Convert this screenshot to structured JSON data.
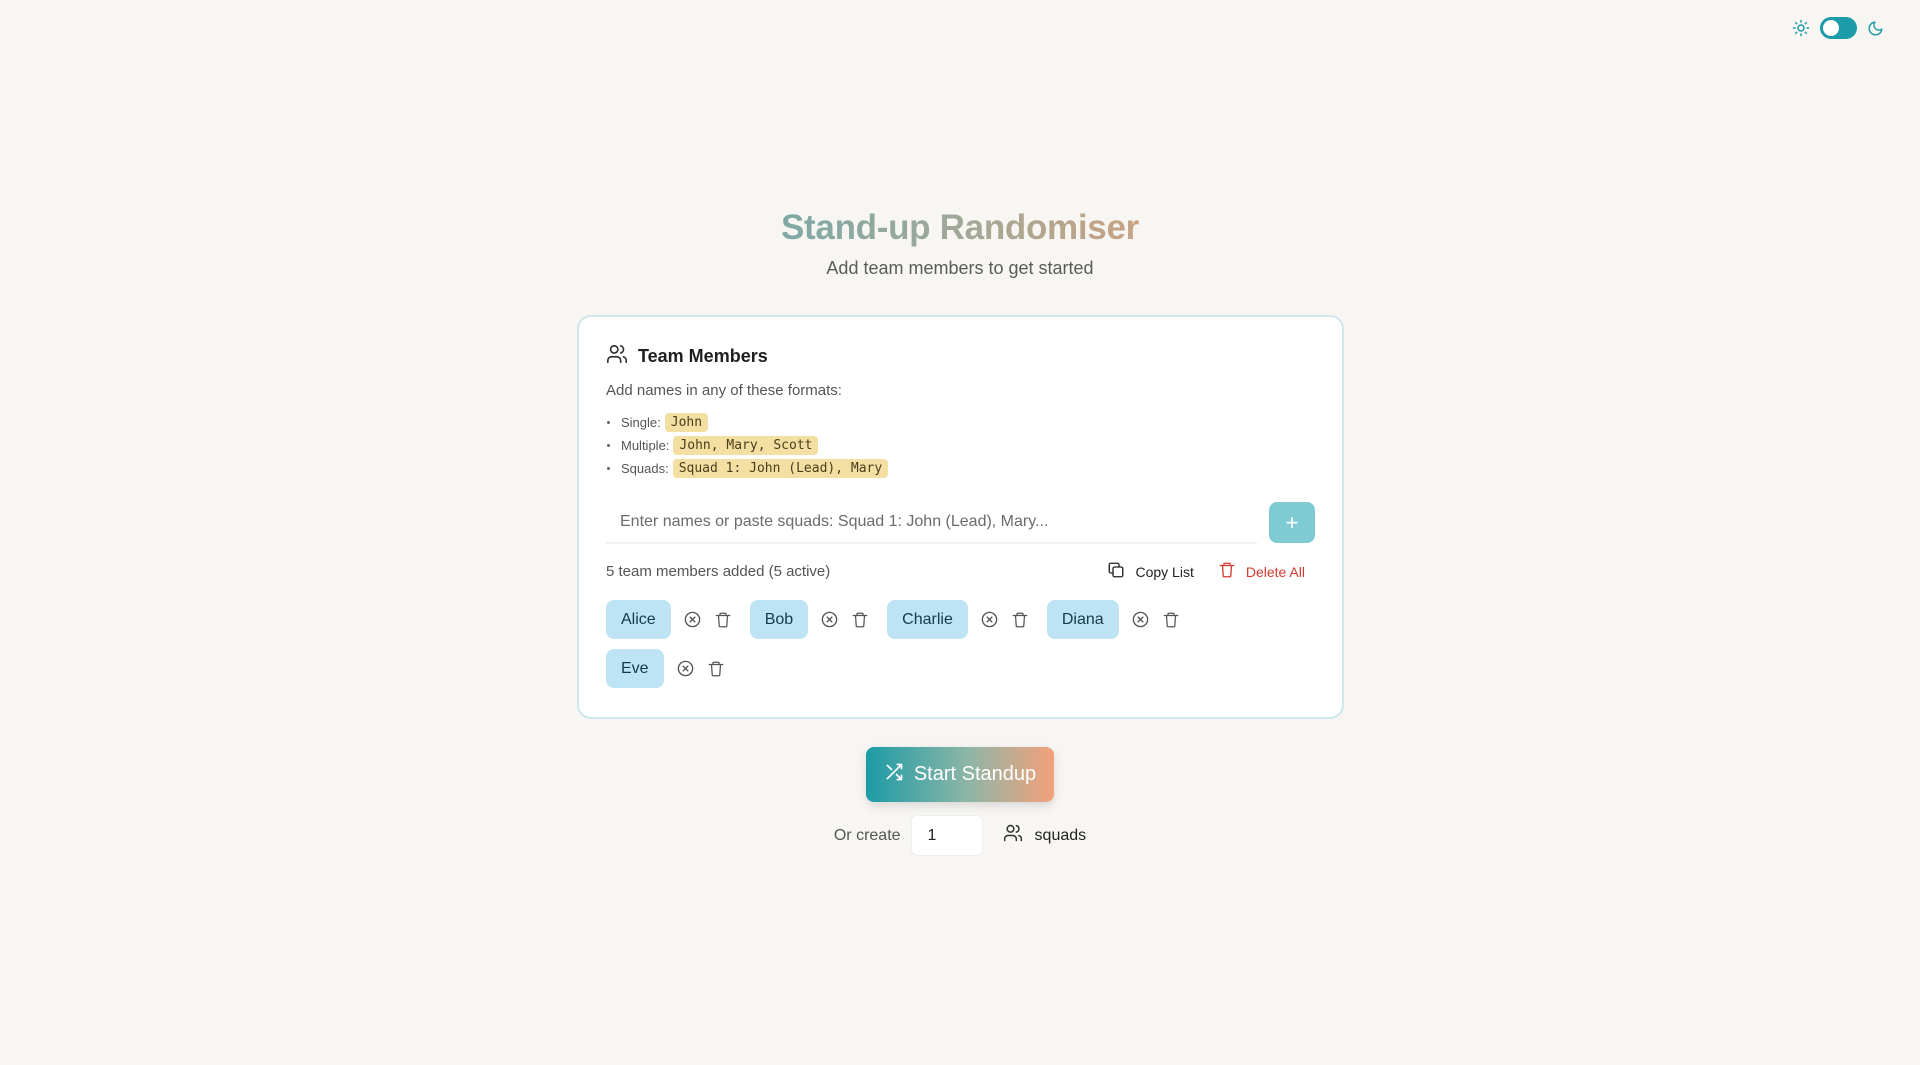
{
  "header": {
    "theme_toggle": {
      "light_icon": "sun-icon",
      "dark_icon": "moon-icon",
      "state": "light"
    }
  },
  "hero": {
    "title": "Stand-up Randomiser",
    "subtitle": "Add team members to get started"
  },
  "card": {
    "title": "Team Members",
    "title_icon": "users-icon",
    "description": "Add names in any of these formats:",
    "formats": [
      {
        "label": "Single:",
        "example": "John"
      },
      {
        "label": "Multiple:",
        "example": "John, Mary, Scott"
      },
      {
        "label": "Squads:",
        "example": "Squad 1: John (Lead), Mary"
      }
    ],
    "input": {
      "placeholder": "Enter names or paste squads: Squad 1: John (Lead), Mary...",
      "value": ""
    },
    "add_button_label": "+",
    "count_text": "5 team members added (5 active)",
    "copy_label": "Copy List",
    "delete_all_label": "Delete All",
    "members": [
      "Alice",
      "Bob",
      "Charlie",
      "Diana",
      "Eve"
    ]
  },
  "start_button_label": "Start Standup",
  "squads": {
    "prefix": "Or create",
    "value": "1",
    "suffix": "squads"
  },
  "colors": {
    "accent": "#1e9ba8",
    "chip": "#bde3f5",
    "code_bg": "#f3dfa1",
    "danger": "#d6392f"
  }
}
